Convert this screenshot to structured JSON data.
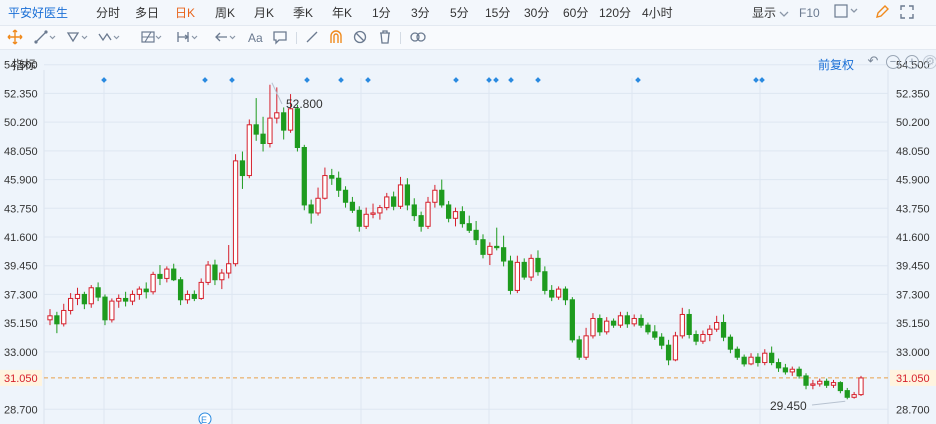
{
  "header": {
    "stock_name": "平安好医生",
    "timeframes": [
      "分时",
      "多日",
      "日K",
      "周K",
      "月K",
      "季K",
      "年K",
      "1分",
      "3分",
      "5分",
      "15分",
      "30分",
      "60分",
      "120分",
      "4小时"
    ],
    "active_timeframe": "日K",
    "display_label": "显示",
    "f10_label": "F10"
  },
  "toolbar": {
    "text_tool_label": "Aa"
  },
  "indicator_bar": {
    "label": "指标",
    "adjust_label": "前复权"
  },
  "chart_data": {
    "type": "candlestick",
    "y_axis_labels": [
      "54.500",
      "52.350",
      "50.200",
      "48.050",
      "45.900",
      "43.750",
      "41.600",
      "39.450",
      "37.300",
      "35.150",
      "33.000",
      "31.050",
      "28.700"
    ],
    "ylim": [
      27.6,
      55.6
    ],
    "current_price": "31.050",
    "high_annotation": "52.800",
    "low_annotation": "29.450",
    "up_color": "#d6202c",
    "down_color": "#1e9b1e",
    "event_marker": "E",
    "ohlc": [
      [
        35.4,
        36.2,
        35.0,
        35.7
      ],
      [
        35.7,
        36.0,
        34.4,
        35.1
      ],
      [
        35.1,
        36.6,
        34.9,
        36.1
      ],
      [
        36.1,
        37.4,
        35.8,
        37.0
      ],
      [
        37.0,
        37.8,
        36.5,
        37.3
      ],
      [
        37.3,
        37.5,
        36.2,
        36.6
      ],
      [
        36.6,
        38.0,
        36.3,
        37.8
      ],
      [
        37.8,
        38.2,
        36.8,
        37.1
      ],
      [
        37.1,
        37.3,
        35.0,
        35.4
      ],
      [
        35.4,
        37.0,
        35.2,
        36.8
      ],
      [
        36.8,
        37.3,
        36.3,
        37.0
      ],
      [
        37.0,
        37.5,
        36.4,
        36.8
      ],
      [
        36.8,
        37.6,
        36.5,
        37.3
      ],
      [
        37.3,
        37.9,
        36.9,
        37.7
      ],
      [
        37.7,
        38.2,
        37.0,
        37.5
      ],
      [
        37.5,
        39.0,
        37.3,
        38.8
      ],
      [
        38.8,
        39.5,
        38.0,
        38.5
      ],
      [
        38.5,
        39.4,
        38.2,
        39.2
      ],
      [
        39.2,
        39.6,
        38.3,
        38.4
      ],
      [
        38.4,
        38.6,
        36.5,
        36.9
      ],
      [
        36.9,
        37.6,
        36.6,
        37.3
      ],
      [
        37.3,
        37.6,
        36.8,
        37.0
      ],
      [
        37.0,
        38.5,
        36.9,
        38.2
      ],
      [
        38.2,
        39.8,
        38.0,
        39.5
      ],
      [
        39.5,
        39.9,
        38.0,
        38.4
      ],
      [
        38.4,
        39.2,
        37.7,
        38.9
      ],
      [
        38.9,
        41.0,
        38.5,
        39.6
      ],
      [
        39.6,
        47.8,
        39.4,
        47.3
      ],
      [
        47.3,
        48.0,
        45.2,
        46.2
      ],
      [
        46.2,
        50.4,
        46.0,
        50.0
      ],
      [
        50.0,
        52.0,
        48.8,
        49.3
      ],
      [
        49.3,
        50.6,
        48.0,
        48.6
      ],
      [
        48.6,
        53.0,
        48.3,
        50.5
      ],
      [
        50.5,
        52.8,
        50.1,
        50.9
      ],
      [
        50.9,
        51.3,
        48.9,
        49.6
      ],
      [
        49.6,
        52.3,
        49.4,
        51.2
      ],
      [
        51.2,
        51.5,
        48.0,
        48.3
      ],
      [
        48.3,
        48.5,
        43.6,
        44.0
      ],
      [
        44.0,
        44.4,
        42.6,
        43.4
      ],
      [
        43.4,
        45.3,
        43.2,
        44.5
      ],
      [
        44.5,
        46.8,
        44.4,
        46.2
      ],
      [
        46.2,
        46.7,
        45.5,
        46.0
      ],
      [
        46.0,
        46.5,
        44.6,
        45.1
      ],
      [
        45.1,
        45.4,
        43.8,
        44.2
      ],
      [
        44.2,
        44.6,
        43.4,
        43.6
      ],
      [
        43.6,
        43.9,
        42.0,
        42.4
      ],
      [
        42.4,
        43.8,
        42.2,
        43.3
      ],
      [
        43.3,
        44.1,
        43.0,
        43.4
      ],
      [
        43.4,
        44.0,
        42.9,
        43.8
      ],
      [
        43.8,
        44.9,
        43.6,
        44.6
      ],
      [
        44.6,
        45.0,
        43.6,
        43.9
      ],
      [
        43.9,
        46.1,
        43.7,
        45.5
      ],
      [
        45.5,
        46.0,
        43.6,
        44.0
      ],
      [
        44.0,
        44.5,
        42.8,
        43.2
      ],
      [
        43.2,
        43.5,
        42.0,
        42.4
      ],
      [
        42.4,
        44.6,
        42.2,
        44.2
      ],
      [
        44.2,
        45.5,
        43.8,
        45.1
      ],
      [
        45.1,
        45.9,
        43.8,
        44.0
      ],
      [
        44.0,
        44.3,
        42.7,
        43.0
      ],
      [
        43.0,
        43.8,
        42.4,
        43.5
      ],
      [
        43.5,
        43.9,
        42.3,
        42.6
      ],
      [
        42.6,
        43.2,
        41.9,
        42.1
      ],
      [
        42.1,
        42.8,
        41.0,
        41.4
      ],
      [
        41.4,
        41.8,
        40.0,
        40.3
      ],
      [
        40.3,
        41.2,
        39.5,
        40.9
      ],
      [
        40.9,
        42.3,
        40.6,
        40.8
      ],
      [
        40.8,
        41.7,
        39.4,
        39.8
      ],
      [
        39.8,
        40.2,
        37.3,
        37.6
      ],
      [
        37.6,
        40.2,
        37.4,
        39.7
      ],
      [
        39.7,
        40.0,
        38.4,
        38.6
      ],
      [
        38.6,
        40.3,
        38.3,
        40.0
      ],
      [
        40.0,
        40.6,
        38.7,
        39.0
      ],
      [
        39.0,
        39.4,
        37.3,
        37.6
      ],
      [
        37.6,
        38.0,
        36.8,
        37.1
      ],
      [
        37.1,
        37.9,
        36.9,
        37.7
      ],
      [
        37.7,
        37.9,
        36.5,
        36.9
      ],
      [
        36.9,
        37.1,
        33.7,
        33.9
      ],
      [
        33.9,
        34.2,
        32.4,
        32.6
      ],
      [
        32.6,
        34.8,
        32.4,
        34.2
      ],
      [
        34.2,
        35.9,
        34.0,
        35.5
      ],
      [
        35.5,
        35.8,
        34.2,
        34.5
      ],
      [
        34.5,
        35.6,
        34.3,
        35.3
      ],
      [
        35.3,
        35.5,
        34.8,
        35.0
      ],
      [
        35.0,
        36.0,
        34.8,
        35.7
      ],
      [
        35.7,
        36.0,
        34.8,
        35.1
      ],
      [
        35.1,
        35.8,
        34.9,
        35.5
      ],
      [
        35.5,
        35.8,
        34.8,
        35.0
      ],
      [
        35.0,
        35.2,
        34.3,
        34.5
      ],
      [
        34.5,
        35.0,
        33.9,
        34.1
      ],
      [
        34.1,
        34.4,
        33.2,
        33.5
      ],
      [
        33.5,
        33.9,
        32.0,
        32.4
      ],
      [
        32.4,
        34.5,
        32.3,
        34.2
      ],
      [
        34.2,
        36.3,
        34.0,
        35.8
      ],
      [
        35.8,
        36.2,
        34.0,
        34.3
      ],
      [
        34.3,
        34.6,
        33.5,
        33.8
      ],
      [
        33.8,
        34.6,
        33.6,
        34.3
      ],
      [
        34.3,
        35.0,
        33.8,
        34.7
      ],
      [
        34.7,
        35.7,
        34.5,
        35.2
      ],
      [
        35.2,
        35.8,
        33.8,
        34.1
      ],
      [
        34.1,
        34.3,
        32.9,
        33.2
      ],
      [
        33.2,
        33.4,
        32.4,
        32.6
      ],
      [
        32.6,
        32.8,
        31.9,
        32.1
      ],
      [
        32.1,
        32.9,
        32.0,
        32.6
      ],
      [
        32.6,
        32.9,
        31.9,
        32.2
      ],
      [
        32.2,
        33.2,
        32.0,
        32.9
      ],
      [
        32.9,
        33.4,
        32.0,
        32.2
      ],
      [
        32.2,
        32.5,
        31.5,
        31.8
      ],
      [
        31.8,
        32.1,
        31.3,
        31.5
      ],
      [
        31.5,
        31.9,
        31.2,
        31.7
      ],
      [
        31.7,
        31.9,
        31.0,
        31.2
      ],
      [
        31.2,
        31.4,
        30.2,
        30.5
      ],
      [
        30.5,
        30.9,
        30.2,
        30.6
      ],
      [
        30.6,
        31.0,
        30.4,
        30.8
      ],
      [
        30.8,
        31.0,
        30.3,
        30.5
      ],
      [
        30.5,
        30.9,
        30.3,
        30.7
      ],
      [
        30.7,
        30.8,
        29.9,
        30.1
      ],
      [
        30.1,
        30.3,
        29.45,
        29.6
      ],
      [
        29.6,
        30.0,
        29.5,
        29.8
      ],
      [
        29.8,
        31.2,
        29.7,
        31.05
      ]
    ]
  }
}
